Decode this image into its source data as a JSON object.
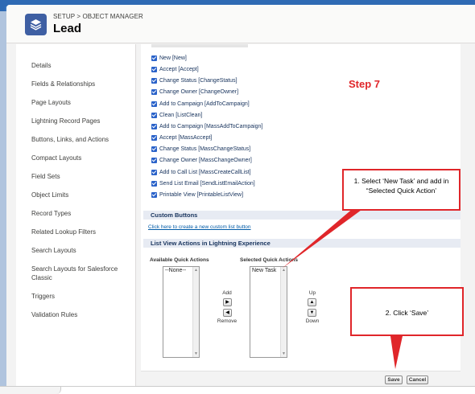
{
  "header": {
    "breadcrumb": "SETUP > OBJECT MANAGER",
    "title": "Lead",
    "icon": "layers-icon"
  },
  "sidebar": {
    "items": [
      {
        "label": "Details"
      },
      {
        "label": "Fields & Relationships"
      },
      {
        "label": "Page Layouts"
      },
      {
        "label": "Lightning Record Pages"
      },
      {
        "label": "Buttons, Links, and Actions"
      },
      {
        "label": "Compact Layouts"
      },
      {
        "label": "Field Sets"
      },
      {
        "label": "Object Limits"
      },
      {
        "label": "Record Types"
      },
      {
        "label": "Related Lookup Filters"
      },
      {
        "label": "Search Layouts"
      },
      {
        "label": "Search Layouts for Salesforce Classic"
      },
      {
        "label": "Triggers"
      },
      {
        "label": "Validation Rules"
      }
    ]
  },
  "list_view_buttons": [
    {
      "label": "New [New]",
      "checked": true
    },
    {
      "label": "Accept [Accept]",
      "checked": true
    },
    {
      "label": "Change Status [ChangeStatus]",
      "checked": true
    },
    {
      "label": "Change Owner [ChangeOwner]",
      "checked": true
    },
    {
      "label": "Add to Campaign [AddToCampaign]",
      "checked": true
    },
    {
      "label": "Clean [ListClean]",
      "checked": true
    },
    {
      "label": "Add to Campaign [MassAddToCampaign]",
      "checked": true
    },
    {
      "label": "Accept [MassAccept]",
      "checked": true
    },
    {
      "label": "Change Status [MassChangeStatus]",
      "checked": true
    },
    {
      "label": "Change Owner [MassChangeOwner]",
      "checked": true
    },
    {
      "label": "Add to Call List [MassCreateCallList]",
      "checked": true
    },
    {
      "label": "Send List Email [SendListEmailAction]",
      "checked": true
    },
    {
      "label": "Printable View [PrintableListView]",
      "checked": true
    }
  ],
  "custom_buttons": {
    "heading": "Custom Buttons",
    "link": "Click here to create a new custom list button"
  },
  "lightning_actions": {
    "heading": "List View Actions in Lightning Experience",
    "available_label": "Available Quick Actions",
    "available_items": [
      "--None--"
    ],
    "selected_label": "Selected Quick Actions",
    "selected_items": [
      "New Task"
    ],
    "add_label": "Add",
    "remove_label": "Remove",
    "up_label": "Up",
    "down_label": "Down"
  },
  "footer": {
    "save_label": "Save",
    "cancel_label": "Cancel"
  },
  "annotations": {
    "step": "Step 7",
    "callout1": "1. Select ‘New Task’ and add in “Selected Quick Action’",
    "callout2": "2. Click ‘Save’",
    "color": "#e0262a"
  }
}
